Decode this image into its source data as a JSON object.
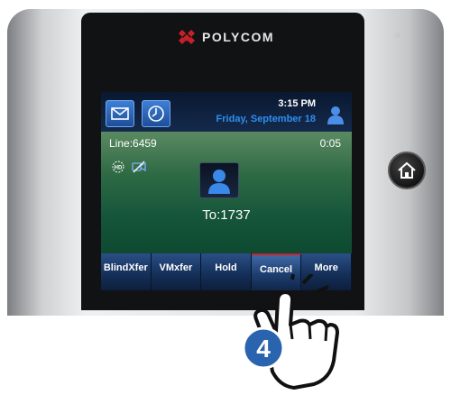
{
  "brand": {
    "name": "POLYCOM"
  },
  "status_bar": {
    "time": "3:15 PM",
    "date": "Friday, September 18",
    "icons": [
      "envelope-icon",
      "clock-icon",
      "user-icon"
    ]
  },
  "call": {
    "line": "Line:6459",
    "timer": "0:05",
    "destination": "To:1737",
    "indicator_icons": [
      "hd-icon",
      "mute-icon"
    ]
  },
  "softkeys": [
    {
      "label": "BlindXfer"
    },
    {
      "label": "VMxfer"
    },
    {
      "label": "Hold"
    },
    {
      "label": "Cancel"
    },
    {
      "label": "More"
    }
  ],
  "step": {
    "number": "4"
  },
  "colors": {
    "screen_green": "#2e6a44",
    "softkey_blue": "#1d3e70",
    "date_blue": "#2f8ef0",
    "step_badge_blue": "#2a63ae",
    "selected_indicator_red": "#c9202c"
  }
}
